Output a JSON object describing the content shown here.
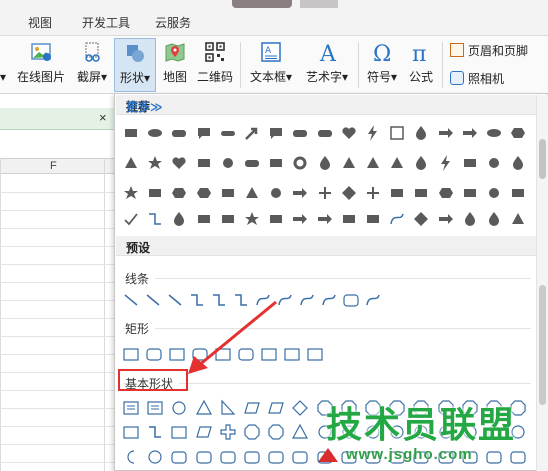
{
  "tabs": [
    "视图",
    "开发工具",
    "云服务"
  ],
  "ribbon": {
    "btn_partial_label": "▾",
    "online_picture": "在线图片",
    "screenshot": "截屏",
    "shapes": "形状",
    "map": "地图",
    "qrcode": "二维码",
    "textbox": "文本框",
    "wordart": "艺术字",
    "symbol": "符号",
    "formula": "公式",
    "header_footer": "页眉和页脚",
    "camera": "照相机",
    "dropdown_caret": "▾"
  },
  "left": {
    "close_label": "×",
    "column_letter": "F"
  },
  "panel": {
    "recommended_title": "推荐",
    "more_label": "更多≫",
    "preset_title": "预设",
    "lines_label": "线条",
    "rect_label": "矩形",
    "basic_label": "基本形状"
  },
  "colors": {
    "accent": "#2b73c4",
    "shape_fill": "#5a5a5a",
    "outline_blue": "#3a6ea5",
    "highlight": "#e53030",
    "watermark": "#23a844"
  },
  "watermark": {
    "title": "技术员联盟",
    "url": "www.jsgho.com"
  }
}
